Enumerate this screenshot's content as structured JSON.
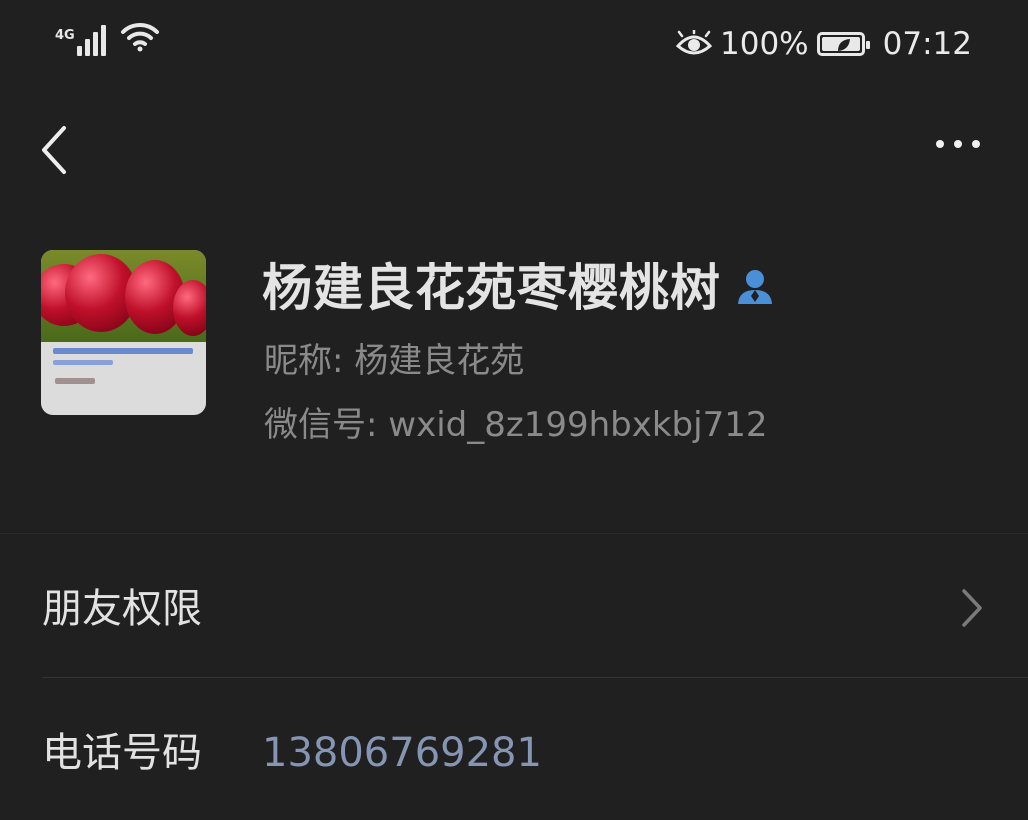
{
  "status_bar": {
    "network": "4G",
    "battery_percent": "100%",
    "time": "07:12",
    "icons": [
      "signal-icon",
      "wifi-icon",
      "eye-icon",
      "battery-icon"
    ]
  },
  "nav": {
    "back_icon": "chevron-left-icon",
    "more_icon": "more-dots-icon"
  },
  "profile": {
    "name": "杨建良花苑枣樱桃树",
    "nickname": "昵称:  杨建良花苑",
    "wechat_id": "微信号:  wxid_8z199hbxkbj712",
    "name_badge_icon": "contact-person-icon"
  },
  "rows": {
    "permissions": {
      "label": "朋友权限"
    },
    "phone": {
      "label": "电话号码",
      "value": "13806769281"
    }
  },
  "colors": {
    "background": "#202020",
    "phone_value": "#8595b4",
    "badge": "#4a90d9"
  }
}
